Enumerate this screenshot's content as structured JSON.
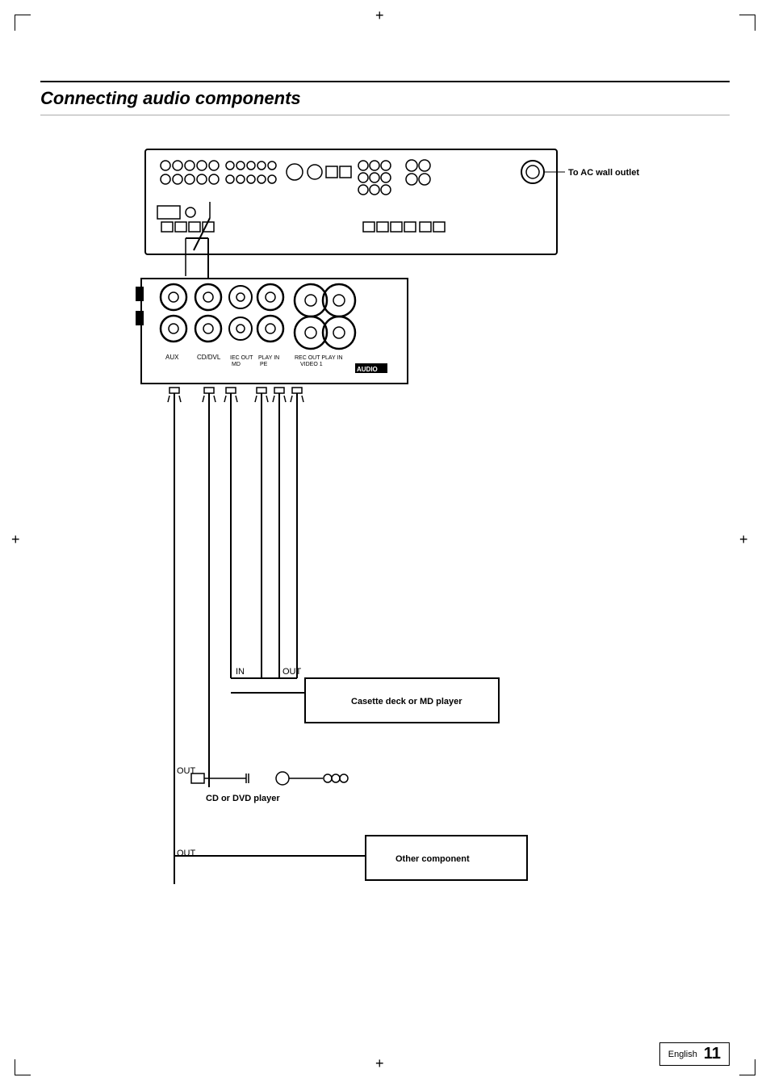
{
  "page": {
    "title": "Connecting audio components",
    "language": "English",
    "page_number": "11"
  },
  "diagram": {
    "ac_outlet_label": "To AC wall outlet",
    "labels": {
      "aux": "AUX",
      "cd_dvl": "CD/DVL",
      "iec_out_md": "IEC OUT MD",
      "play_in_pe": "PLAY IN PE",
      "rec_out": "REC OUT",
      "play_in_video": "PLAY IN VIDEO 1",
      "audio": "AUDIO",
      "in_label": "IN",
      "out_label": "OUT",
      "out_label2": "OUT",
      "out_label3": "OUT"
    },
    "devices": {
      "cassette": "Casette deck or MD player",
      "cd_dvd": "CD or DVD player",
      "other": "Other component"
    }
  }
}
